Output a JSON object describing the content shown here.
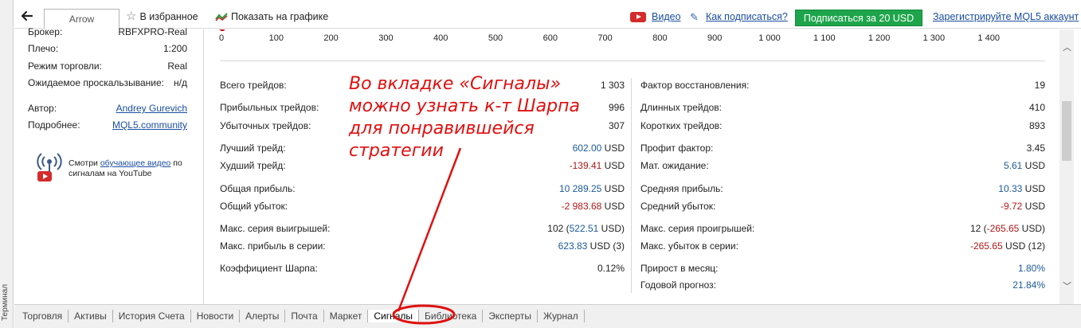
{
  "toolbar": {
    "tab_label": "Arrow",
    "favorites": "В избранное",
    "show_chart": "Показать на графике",
    "video": "Видео",
    "how_to_subscribe": "Как подписаться?",
    "subscribe_button": "Подписаться за 20 USD",
    "register": "Зарегистрируйте MQL5 аккаунт",
    "colors": {
      "subscribe_bg": "#1ea54b",
      "link": "#1a4ea0"
    }
  },
  "left_panel": {
    "rows": [
      {
        "key": "Брокер:",
        "value": "RBFXPRO-Real"
      },
      {
        "key": "Плечо:",
        "value": "1:200"
      },
      {
        "key": "Режим торговли:",
        "value": "Real"
      },
      {
        "key": "Ожидаемое проскальзывание:",
        "value": "н/д"
      },
      {
        "key": "Автор:",
        "value": "Andrey Gurevich"
      },
      {
        "key": "Подробнее:",
        "value": "MQL5.community"
      }
    ],
    "video_text_1": "Смотри ",
    "video_link": "обучающее видео",
    "video_text_2": " по сигналам на YouTube"
  },
  "x_axis": [
    "0",
    "100",
    "200",
    "300",
    "400",
    "500",
    "600",
    "700",
    "800",
    "900",
    "1 000",
    "1 100",
    "1 200",
    "1 300",
    "1 400"
  ],
  "stats_left": [
    {
      "key": "Всего трейдов:",
      "value": "1 303"
    },
    {
      "key": "Прибыльных трейдов:",
      "value": "996"
    },
    {
      "key": "Убыточных трейдов:",
      "value": "307"
    },
    {
      "key": "Лучший трейд:",
      "value": "602.00",
      "unit": " USD"
    },
    {
      "key": "Худший трейд:",
      "value": "-139.41",
      "unit": " USD"
    },
    {
      "key": "Общая прибыль:",
      "value": "10 289.25",
      "unit": " USD"
    },
    {
      "key": "Общий убыток:",
      "value": "-2 983.68",
      "unit": " USD"
    },
    {
      "key": "Макс. серия выигрышей:",
      "value_pre": "102 (",
      "value": "522.51",
      "unit": " USD)"
    },
    {
      "key": "Макс. прибыль в серии:",
      "value": "623.83",
      "unit": " USD (3)"
    },
    {
      "key": "Коэффициент Шарпа:",
      "value": "0.12%"
    }
  ],
  "stats_right": [
    {
      "key": "Фактор восстановления:",
      "value": "19"
    },
    {
      "key": "Длинных трейдов:",
      "value": "410"
    },
    {
      "key": "Коротких трейдов:",
      "value": "893"
    },
    {
      "key": "Профит фактор:",
      "value": "3.45"
    },
    {
      "key": "Мат. ожидание:",
      "value": "5.61",
      "unit": " USD"
    },
    {
      "key": "Средняя прибыль:",
      "value": "10.33",
      "unit": " USD"
    },
    {
      "key": "Средний убыток:",
      "value": "-9.72",
      "unit": " USD"
    },
    {
      "key": "Макс. серия проигрышей:",
      "value_pre": "12 (",
      "value": "-265.65",
      "unit": " USD)"
    },
    {
      "key": "Макс. убыток в серии:",
      "value": "-265.65",
      "unit": " USD (12)"
    },
    {
      "key": "Прирост в месяц:",
      "value": "1.80%"
    },
    {
      "key": "Годовой прогноз:",
      "value": "21.84%"
    }
  ],
  "annotation": {
    "lines": [
      "Во вкладке «Сигналы»",
      "можно узнать к-т Шарпа",
      "для понравившейся",
      "стратегии"
    ],
    "color": "#e01010"
  },
  "bottom_tabs": [
    "Торговля",
    "Активы",
    "История Счета",
    "Новости",
    "Алерты",
    "Почта",
    "Маркет",
    "Сигналы",
    "Библиотека",
    "Эксперты",
    "Журнал"
  ],
  "active_tab": "Сигналы",
  "terminal_label": "Терминал",
  "colors": {
    "positive": "#1a5a9a",
    "negative": "#b01818"
  }
}
